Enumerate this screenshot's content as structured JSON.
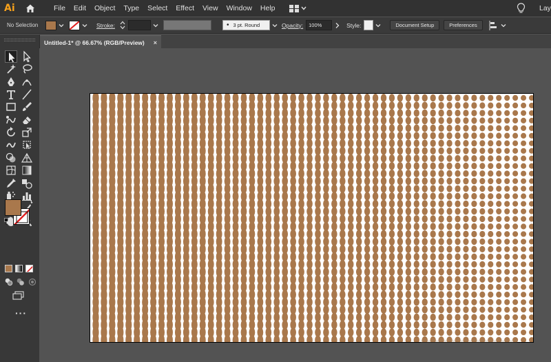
{
  "app": {
    "logo": "Ai",
    "menus": [
      "File",
      "Edit",
      "Object",
      "Type",
      "Select",
      "Effect",
      "View",
      "Window",
      "Help"
    ],
    "workspace_label": "Layo",
    "icons": [
      "home-icon",
      "arrange-documents-icon",
      "lightbulb-icon"
    ]
  },
  "control_bar": {
    "selection_status": "No Selection",
    "fill_color": "#a9784c",
    "stroke_label": "Stroke:",
    "brush_value": "3 pt. Round",
    "opacity_label": "Opacity:",
    "opacity_value": "100%",
    "style_label": "Style:",
    "document_setup_label": "Document Setup",
    "preferences_label": "Preferences"
  },
  "document_tab": {
    "title": "Untitled-1* @ 66.67% (RGB/Preview)",
    "close_glyph": "×"
  },
  "colors": {
    "fill": "#a9784c",
    "pattern_dots": "#a9784c",
    "artboard_background": "#ffffff",
    "accent_logo": "#f7a11b"
  },
  "artwork": {
    "description_type": "halftone-gradient-dot-pattern",
    "columns": 54,
    "rows": 33
  },
  "toolbar": {
    "tools": [
      "selection-tool-icon",
      "direct-selection-tool-icon",
      "magic-wand-tool-icon",
      "lasso-tool-icon",
      "pen-tool-icon",
      "curvature-tool-icon",
      "type-tool-icon",
      "line-tool-icon",
      "rectangle-tool-icon",
      "paintbrush-tool-icon",
      "shaper-tool-icon",
      "eraser-tool-icon",
      "rotate-tool-icon",
      "scale-tool-icon",
      "warp-tool-icon",
      "free-transform-tool-icon",
      "shape-builder-tool-icon",
      "perspective-grid-tool-icon",
      "mesh-tool-icon",
      "gradient-tool-icon",
      "eyedropper-tool-icon",
      "blend-tool-icon",
      "symbol-sprayer-tool-icon",
      "column-graph-tool-icon",
      "artboard-tool-icon",
      "slice-tool-icon",
      "hand-tool-icon",
      "zoom-tool-icon"
    ]
  }
}
